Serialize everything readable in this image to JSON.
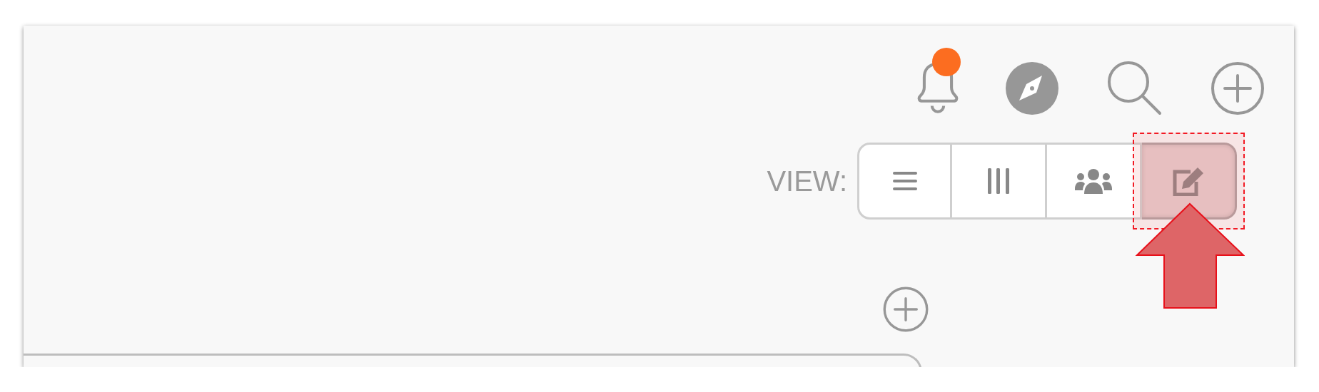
{
  "header_icons": [
    {
      "kind": "bell",
      "badge": true
    },
    {
      "kind": "compass"
    },
    {
      "kind": "search"
    },
    {
      "kind": "add"
    }
  ],
  "view_switcher": {
    "label": "VIEW:",
    "options": [
      {
        "kind": "list",
        "selected": false,
        "annotated": false
      },
      {
        "kind": "columns",
        "selected": false,
        "annotated": false
      },
      {
        "kind": "people",
        "selected": false,
        "annotated": false
      },
      {
        "kind": "edit",
        "selected": true,
        "annotated": true
      }
    ]
  },
  "add_button": {
    "kind": "add"
  }
}
